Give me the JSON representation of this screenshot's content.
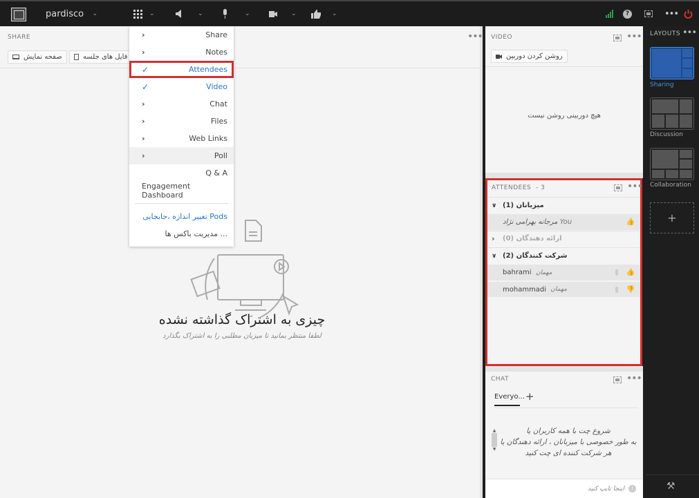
{
  "topbar": {
    "app_name": "pardisco",
    "icons": [
      "apps-grid-icon",
      "speaker-icon",
      "microphone-icon",
      "camera-icon",
      "thumbs-up-icon"
    ],
    "right_icons": [
      "signal-icon",
      "help-icon",
      "fullscreen-icon",
      "more-icon",
      "power-icon"
    ]
  },
  "share": {
    "header": "SHARE",
    "btn_screen": "صفحه نمایش",
    "btn_files": "فایل های جلسه",
    "empty_title": "چیزی به اشتراک گذاشته نشده",
    "empty_sub": "لطفا منتظر بمانید تا میزبان مطلبی را به اشتراک بگذارد"
  },
  "menu": {
    "items": [
      {
        "label": "Share",
        "state": "arrow"
      },
      {
        "label": "Notes",
        "state": "arrow"
      },
      {
        "label": "Attendees",
        "state": "checked"
      },
      {
        "label": "Video",
        "state": "checked"
      },
      {
        "label": "Chat",
        "state": "arrow"
      },
      {
        "label": "Files",
        "state": "arrow"
      },
      {
        "label": "Web Links",
        "state": "arrow"
      },
      {
        "label": "Poll",
        "state": "arrow"
      },
      {
        "label": "Q & A",
        "state": "none"
      },
      {
        "label": "Engagement Dashboard",
        "state": "none"
      }
    ],
    "pods_label": "تغییر اندازه ،جابجایی Pods",
    "manage_label": "مدیریت باکس ها ..."
  },
  "video": {
    "header": "VIDEO",
    "camera_btn": "روشن کردن دوربین",
    "empty": "هیچ دوربینی روشن نیست"
  },
  "attendees": {
    "header": "ATTENDEES",
    "count": "- 3",
    "groups": [
      {
        "label": "میزبانان (1)",
        "members": [
          {
            "name": "مرجانه بهرامی نژاد",
            "tag": "You",
            "status": "thumbs-up"
          }
        ]
      },
      {
        "label": "ارائه دهندگان (0)",
        "members": []
      },
      {
        "label": "شرکت کنندگان (2)",
        "members": [
          {
            "name": "bahrami",
            "tag": "مهمان",
            "status": "thumbs-up"
          },
          {
            "name": "mohammadi",
            "tag": "مهمان",
            "status": "thumbs-down"
          }
        ]
      }
    ]
  },
  "chat": {
    "header": "CHAT",
    "tab": "Everyo...",
    "add": "+",
    "line1": "شروع چت با همه کاربران یا",
    "line2": "به طور خصوصی با میزبانان ، ارائه دهندگان یا",
    "line3": "هر شرکت کننده ای چت کنید",
    "placeholder": "اینجا تایپ کنید"
  },
  "layouts": {
    "header": "LAYOUTS",
    "items": [
      {
        "label": "Sharing",
        "active": true
      },
      {
        "label": "Discussion",
        "active": false
      },
      {
        "label": "Collaboration",
        "active": false
      }
    ],
    "add": "+"
  },
  "colors": {
    "accent": "#2a76c6",
    "highlight": "#d32f2f",
    "green": "#2e9b4f",
    "red": "#d32f2f"
  }
}
